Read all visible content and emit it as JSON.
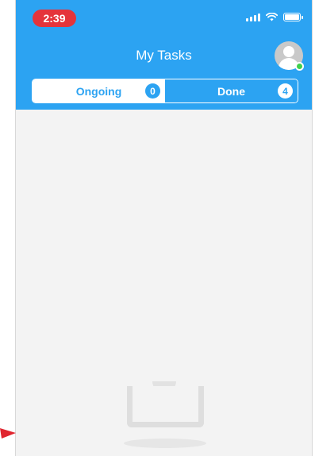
{
  "status_bar": {
    "time": "2:39",
    "icons": [
      "cellular-signal-icon",
      "wifi-icon",
      "battery-icon"
    ]
  },
  "header": {
    "title": "My Tasks",
    "avatar_icon": "user-avatar-icon",
    "online_indicator": "online-status-dot"
  },
  "tabs": [
    {
      "label": "Ongoing",
      "count": "0",
      "selected": true
    },
    {
      "label": "Done",
      "count": "4",
      "selected": false
    }
  ],
  "empty_state": {
    "illustration_icon": "empty-tray-icon"
  },
  "overlay": {
    "pointer_icon": "red-arrow-pointer-icon"
  },
  "colors": {
    "header_blue": "#2ca3f2",
    "time_pill_red": "#e5343b",
    "online_green": "#3fd14b",
    "screen_bg": "#f3f3f3",
    "pointer_red": "#e0252f"
  }
}
